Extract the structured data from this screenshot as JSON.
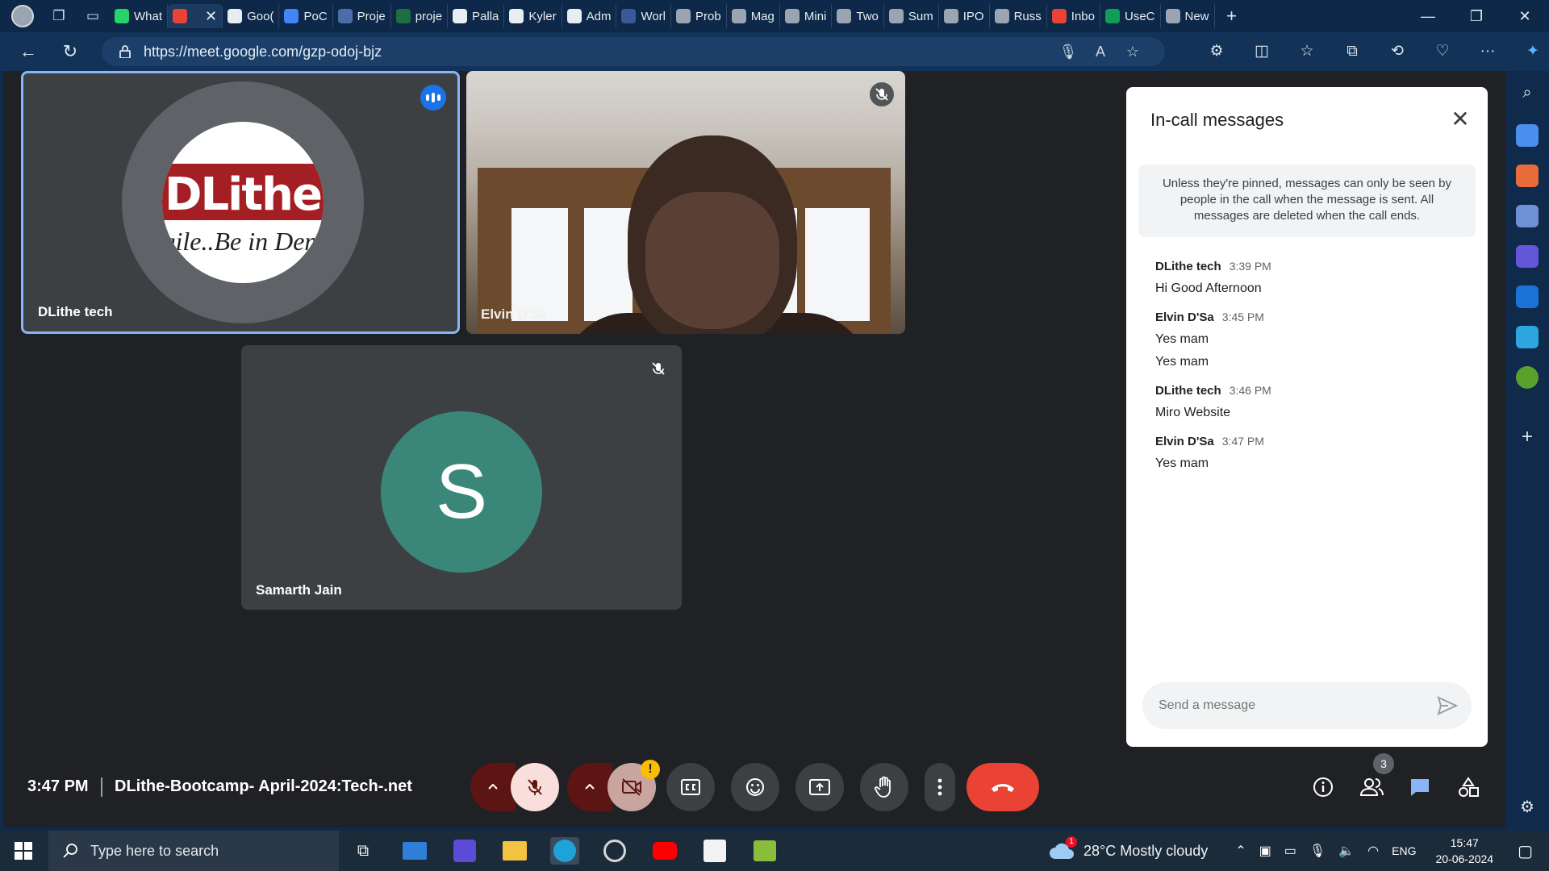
{
  "browser": {
    "tabs": [
      {
        "label": "What",
        "color": "#25d366"
      },
      {
        "label": "",
        "color": "#ea4335",
        "active": true
      },
      {
        "label": "Goo(",
        "color": "#e8edf3"
      },
      {
        "label": "PoC",
        "color": "#4285f4"
      },
      {
        "label": "Proje",
        "color": "#4a6ea8"
      },
      {
        "label": "proje",
        "color": "#1d6f42"
      },
      {
        "label": "Palla",
        "color": "#e8edf3"
      },
      {
        "label": "Kyler",
        "color": "#e8edf3"
      },
      {
        "label": "Adm",
        "color": "#e8edf3"
      },
      {
        "label": "Worl",
        "color": "#3b5998"
      },
      {
        "label": "Prob",
        "color": "#9aa5b1"
      },
      {
        "label": "Mag",
        "color": "#9aa5b1"
      },
      {
        "label": "Mini",
        "color": "#9aa5b1"
      },
      {
        "label": "Two",
        "color": "#9aa5b1"
      },
      {
        "label": "Sum",
        "color": "#9aa5b1"
      },
      {
        "label": "IPO",
        "color": "#9aa5b1"
      },
      {
        "label": "Russ",
        "color": "#9aa5b1"
      },
      {
        "label": "Inbo",
        "color": "#ea4335"
      },
      {
        "label": "UseC",
        "color": "#0f9d58"
      },
      {
        "label": "New",
        "color": "#9aa5b1"
      }
    ],
    "url": "https://meet.google.com/gzp-odoj-bjz"
  },
  "participants": [
    {
      "name": "DLithe tech",
      "logo_main": "DLithe",
      "logo_tag": "gile..Be in Dem"
    },
    {
      "name": "Elvin D'Sa"
    },
    {
      "name": "Samarth Jain",
      "initial": "S",
      "avatar_color": "#3a877a"
    }
  ],
  "chat": {
    "title": "In-call messages",
    "notice": "Unless they're pinned, messages can only be seen by people in the call when the message is sent. All messages are deleted when the call ends.",
    "messages": [
      {
        "sender": "DLithe tech",
        "time": "3:39 PM",
        "lines": [
          "Hi Good Afternoon"
        ]
      },
      {
        "sender": "Elvin D'Sa",
        "time": "3:45 PM",
        "lines": [
          "Yes mam",
          "Yes mam"
        ]
      },
      {
        "sender": "DLithe tech",
        "time": "3:46 PM",
        "lines": [
          "Miro Website"
        ]
      },
      {
        "sender": "Elvin D'Sa",
        "time": "3:47 PM",
        "lines": [
          "Yes mam"
        ]
      }
    ],
    "input_placeholder": "Send a message"
  },
  "meeting": {
    "time": "3:47 PM",
    "name": "DLithe-Bootcamp- April-2024:Tech-.net",
    "people_count": "3",
    "camera_warning": "!"
  },
  "taskbar": {
    "search_placeholder": "Type here to search",
    "weather": "28°C  Mostly cloudy",
    "weather_badge": "1",
    "language": "ENG",
    "time": "15:47",
    "date": "20-06-2024"
  },
  "colors": {
    "meet_bg": "#202124",
    "tile_bg": "#3c4043",
    "end_call": "#ea4335",
    "speaking_border": "#8ab4f8"
  }
}
